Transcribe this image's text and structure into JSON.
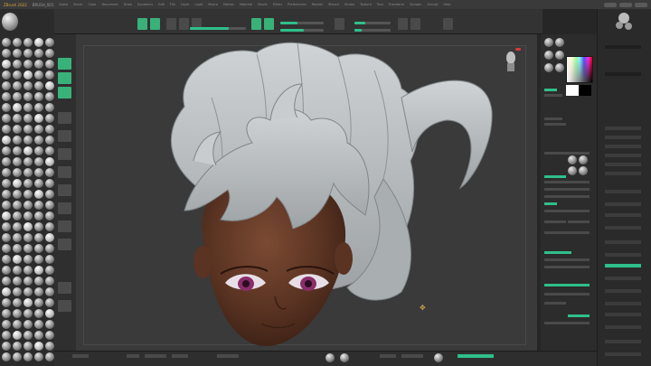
{
  "app": {
    "title": "ZBrush 2022",
    "document": "BRUSH_001",
    "menu": [
      "Alpha",
      "Brush",
      "Color",
      "Document",
      "Draw",
      "Dynamics",
      "Edit",
      "File",
      "Layer",
      "Light",
      "Macro",
      "Marker",
      "Material",
      "Movie",
      "Picker",
      "Preferences",
      "Render",
      "Stencil",
      "Stroke",
      "Texture",
      "Tool",
      "Transform",
      "Zplugin",
      "Zscript",
      "Help"
    ]
  },
  "colors": {
    "accent": "#39b27a",
    "slider_fill": "#2fbf8b",
    "panel": "#2c2c2c",
    "viewport": "#3a3a3a",
    "menu_title": "#d9a441",
    "navigator_dot": "#d23a3a",
    "skin": "#5a3322",
    "hair": "#b8bcbf",
    "eyes": "#8a2e6a"
  },
  "icons": {
    "edit": "edit-icon",
    "draw": "draw-icon",
    "move": "move-icon",
    "scale": "scale-icon",
    "rotate": "rotate-icon",
    "pivot": "pivot-icon",
    "head_navigator": "head-navigator-icon",
    "brush": "brush-sphere-icon"
  },
  "viewport": {
    "model": "stylized female head with swept hair sculpt"
  }
}
